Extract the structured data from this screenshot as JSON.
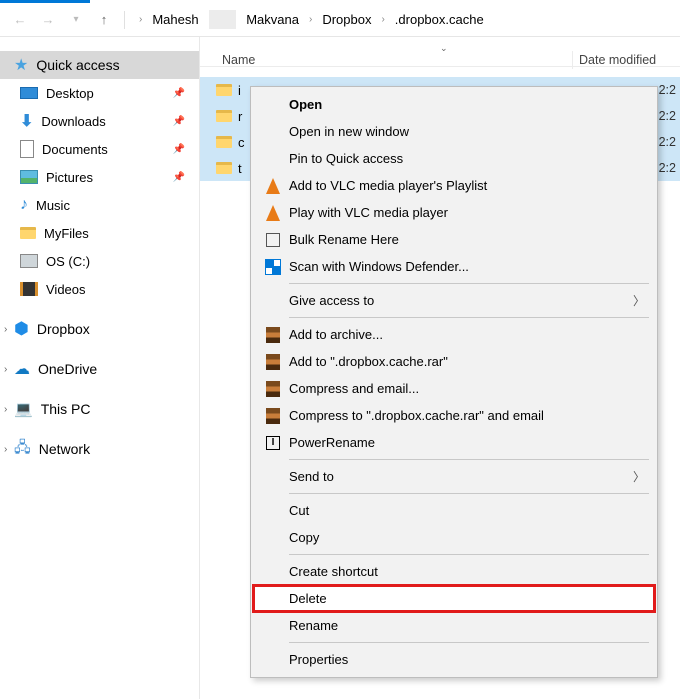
{
  "breadcrumb": {
    "seg1": "Mahesh",
    "seg2": "Makvana",
    "seg3": "Dropbox",
    "seg4": ".dropbox.cache"
  },
  "columns": {
    "name": "Name",
    "date": "Date modified"
  },
  "sidebar": {
    "quick": "Quick access",
    "desktop": "Desktop",
    "downloads": "Downloads",
    "documents": "Documents",
    "pictures": "Pictures",
    "music": "Music",
    "myfiles": "MyFiles",
    "osc": "OS (C:)",
    "videos": "Videos",
    "dropbox": "Dropbox",
    "onedrive": "OneDrive",
    "thispc": "This PC",
    "network": "Network"
  },
  "files": {
    "t1": "2:2",
    "t2": "2:2",
    "t3": "2:2",
    "t4": "2:2"
  },
  "ctx": {
    "open": "Open",
    "open_new": "Open in new window",
    "pin": "Pin to Quick access",
    "vlc_pl": "Add to VLC media player's Playlist",
    "vlc_play": "Play with VLC media player",
    "bulk": "Bulk Rename Here",
    "scan": "Scan with Windows Defender...",
    "give": "Give access to",
    "archive": "Add to archive...",
    "add_rar": "Add to \".dropbox.cache.rar\"",
    "comp_email": "Compress and email...",
    "comp_rar_email": "Compress to \".dropbox.cache.rar\" and email",
    "pr": "PowerRename",
    "sendto": "Send to",
    "cut": "Cut",
    "copy": "Copy",
    "shortcut": "Create shortcut",
    "delete": "Delete",
    "rename": "Rename",
    "props": "Properties"
  }
}
